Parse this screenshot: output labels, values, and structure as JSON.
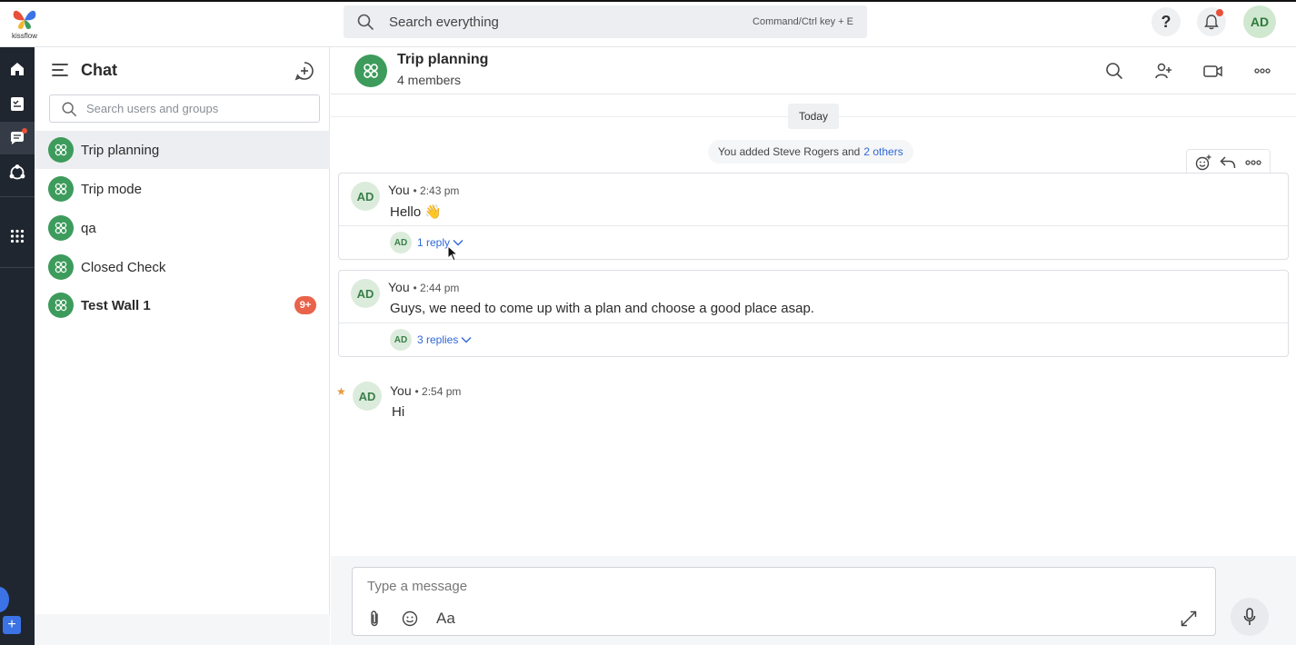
{
  "brand": {
    "logo_text": "kissflow",
    "accent": "#3d9b5c"
  },
  "topbar": {
    "search_placeholder": "Search everything",
    "search_hint": "Command/Ctrl key + E",
    "help_label": "?",
    "user_initials": "AD"
  },
  "rail": {
    "items": [
      "home-icon",
      "tasks-icon",
      "chat-icon",
      "integrations-icon",
      "apps-grid-icon"
    ],
    "add_label": "+"
  },
  "panel": {
    "title": "Chat",
    "search_placeholder": "Search users and groups",
    "chats": [
      {
        "name": "Trip planning",
        "active": true
      },
      {
        "name": "Trip mode"
      },
      {
        "name": "qa"
      },
      {
        "name": "Closed Check"
      },
      {
        "name": "Test Wall 1",
        "bold": true,
        "badge": "9+"
      }
    ]
  },
  "conversation": {
    "title": "Trip planning",
    "members": "4 members",
    "date_divider": "Today",
    "system_message": "You added Steve Rogers and",
    "system_link": "2 others",
    "messages": [
      {
        "initials": "AD",
        "sender": "You",
        "time": "• 2:43 pm",
        "text": "Hello 👋",
        "reply_initials": "AD",
        "replies": "1 reply"
      },
      {
        "initials": "AD",
        "sender": "You",
        "time": "• 2:44 pm",
        "text": "Guys, we need to come up with a plan and choose a good place asap.",
        "reply_initials": "AD",
        "replies": "3 replies"
      },
      {
        "initials": "AD",
        "sender": "You",
        "time": "• 2:54 pm",
        "text": "Hi",
        "starred": true
      }
    ]
  },
  "composer": {
    "placeholder": "Type a message",
    "format_label": "Aa"
  }
}
